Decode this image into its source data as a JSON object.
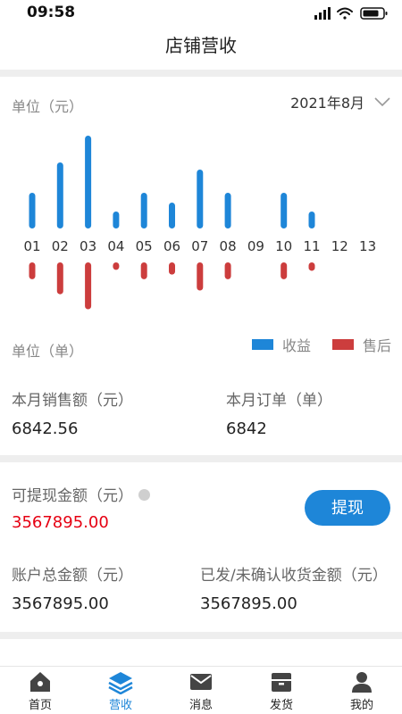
{
  "status_bar": {
    "time": "09:58"
  },
  "header": {
    "title": "店铺营收"
  },
  "chart_section": {
    "unit_top": "单位（元）",
    "month": "2021年8月",
    "unit_bottom": "单位（单）"
  },
  "chart_data": {
    "type": "bar",
    "categories": [
      "01",
      "02",
      "03",
      "04",
      "05",
      "06",
      "07",
      "08",
      "09",
      "10",
      "11",
      "12",
      "13"
    ],
    "series": [
      {
        "name": "收益",
        "values": [
          40,
          74,
          104,
          19,
          40,
          29,
          66,
          40,
          0,
          40,
          19,
          0,
          0
        ]
      },
      {
        "name": "售后",
        "values": [
          18,
          34,
          50,
          8,
          18,
          13,
          30,
          18,
          0,
          18,
          9,
          0,
          0
        ]
      }
    ],
    "colors": {
      "收益": "#1e86d8",
      "售后": "#cc3d3d"
    }
  },
  "stats": {
    "monthly_sales_label": "本月销售额（元）",
    "monthly_sales_value": "6842.56",
    "monthly_orders_label": "本月订单（单）",
    "monthly_orders_value": "6842"
  },
  "balance": {
    "withdrawable_label": "可提现金额（元）",
    "withdrawable_value": "3567895.00",
    "withdraw_button": "提现",
    "total_label": "账户总金额（元）",
    "total_value": "3567895.00",
    "shipped_label": "已发/未确认收货金额（元）",
    "shipped_value": "3567895.00"
  },
  "tabs": [
    {
      "label": "首页",
      "icon": "home-icon",
      "active": false
    },
    {
      "label": "营收",
      "icon": "layers-icon",
      "active": true
    },
    {
      "label": "消息",
      "icon": "mail-icon",
      "active": false
    },
    {
      "label": "发货",
      "icon": "box-icon",
      "active": false
    },
    {
      "label": "我的",
      "icon": "user-icon",
      "active": false
    }
  ],
  "theme": {
    "accent": "#1e86d8",
    "danger": "#e60012"
  }
}
